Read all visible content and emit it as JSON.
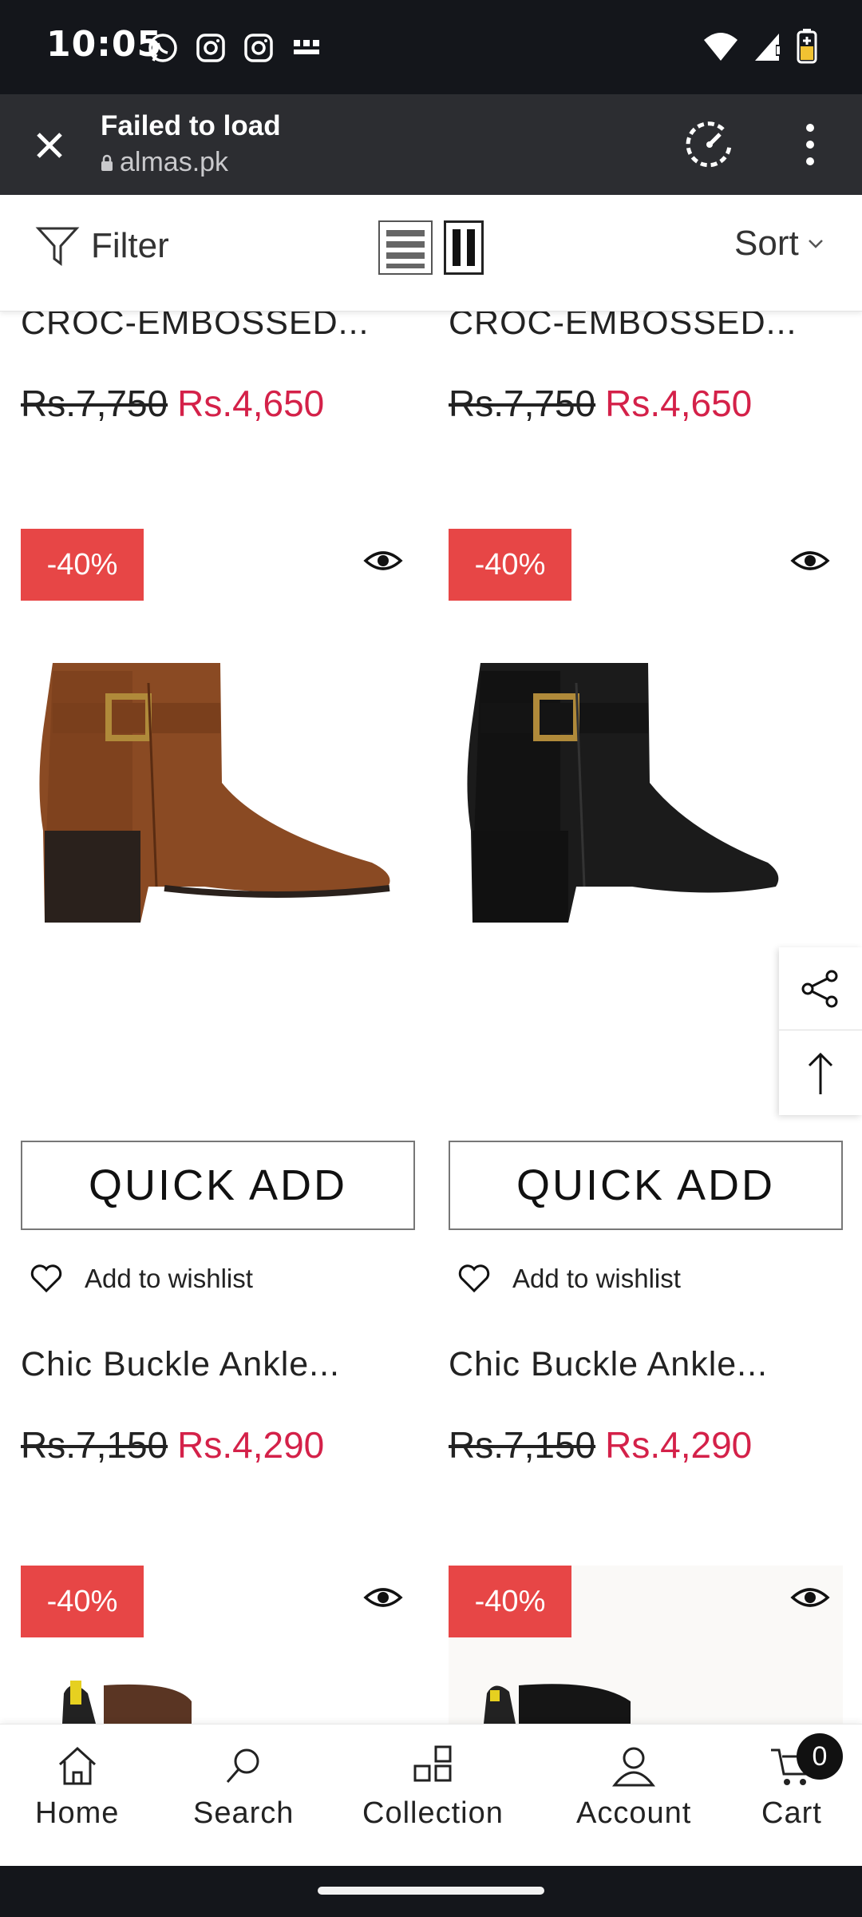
{
  "status_bar": {
    "time": "10:05"
  },
  "browser": {
    "title": "Failed to load",
    "url": "almas.pk"
  },
  "toolbar": {
    "filter_label": "Filter",
    "sort_label": "Sort"
  },
  "top_row": {
    "left": {
      "name": "CROC-EMBOSSED...",
      "old_price": "Rs.7,750",
      "new_price": "Rs.4,650"
    },
    "right": {
      "name": "CROC-EMBOSSED...",
      "old_price": "Rs.7,750",
      "new_price": "Rs.4,650"
    }
  },
  "products": [
    {
      "badge": "-40%",
      "quick_add": "QUICK ADD",
      "wishlist": "Add to wishlist",
      "name": "Chic Buckle Ankle...",
      "old_price": "Rs.7,150",
      "new_price": "Rs.4,290",
      "color": "#8a4a23"
    },
    {
      "badge": "-40%",
      "quick_add": "QUICK ADD",
      "wishlist": "Add to wishlist",
      "name": "Chic Buckle Ankle...",
      "old_price": "Rs.7,150",
      "new_price": "Rs.4,290",
      "color": "#1b1b1b"
    }
  ],
  "next_row": {
    "left_badge": "-40%",
    "right_badge": "-40%"
  },
  "bottom_nav": {
    "home": "Home",
    "search": "Search",
    "collection": "Collection",
    "account": "Account",
    "cart": "Cart",
    "cart_count": "0"
  },
  "colors": {
    "sale_price": "#d42149",
    "badge": "#e74646"
  }
}
